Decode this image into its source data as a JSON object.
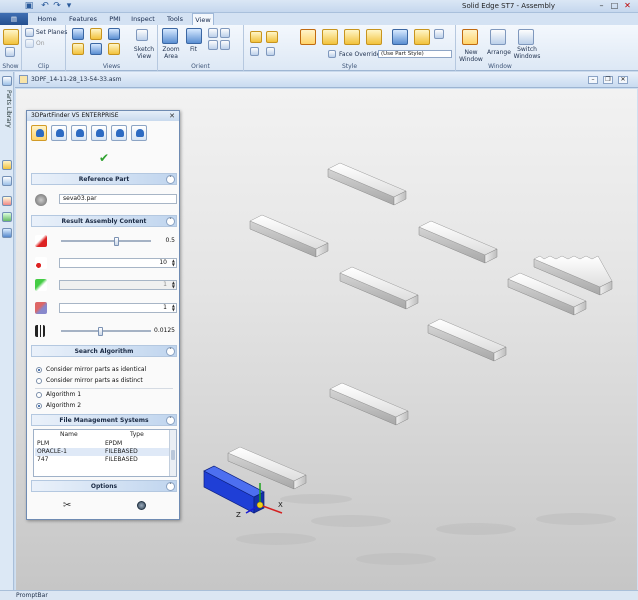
{
  "app": {
    "title": "Solid Edge ST7 - Assembly"
  },
  "tabs": [
    "Home",
    "Features",
    "PMI",
    "Inspect",
    "Tools",
    "View"
  ],
  "active_tab": "View",
  "ribbon": {
    "groups": [
      "Show",
      "Clip",
      "Views",
      "Orient",
      "Style",
      "Window"
    ],
    "set_planes_label": "Set Planes",
    "on_label": "On",
    "sketch_view_label": "Sketch View",
    "zoom_area_label": "Zoom Area",
    "fit_label": "Fit",
    "face_overrides_label": "Face Overrides",
    "part_style_value": "(Use Part Style)",
    "new_window_label": "New Window",
    "arrange_label": "Arrange",
    "switch_windows_label": "Switch Windows"
  },
  "left_strip": {
    "parts_library_label": "Parts Library"
  },
  "document": {
    "title": "3DPF_14-11-28_13-54-33.asm"
  },
  "statusbar": {
    "text": "PromptBar"
  },
  "panel": {
    "title": "3DPartFinder V5 ENTERPRISE",
    "reference_part": {
      "header": "Reference Part",
      "value": "seva03.par"
    },
    "result_assembly": {
      "header": "Result Assembly Content",
      "slider1_value": "0.5",
      "count_value": "10",
      "field2_value": "1",
      "field3_value": "1",
      "slider2_value": "0.0125"
    },
    "search_algorithm": {
      "header": "Search Algorithm",
      "options": [
        "Consider mirror parts as identical",
        "Consider mirror parts as distinct",
        "Algorithm 1",
        "Algorithm 2"
      ],
      "selected": [
        "Consider mirror parts as identical",
        "Algorithm 2"
      ]
    },
    "fms": {
      "header": "File Management Systems",
      "columns": [
        "Name",
        "Type"
      ],
      "rows": [
        {
          "name": "PLM",
          "type": "EPDM"
        },
        {
          "name": "ORACLE-1",
          "type": "FILEBASED"
        },
        {
          "name": "747",
          "type": "FILEBASED"
        }
      ]
    },
    "options": {
      "header": "Options"
    }
  },
  "colors": {
    "selected_part": "#1f3fd6",
    "part_gray": "#e8e8e8",
    "ribbon_blue": "#d4e2f3"
  }
}
